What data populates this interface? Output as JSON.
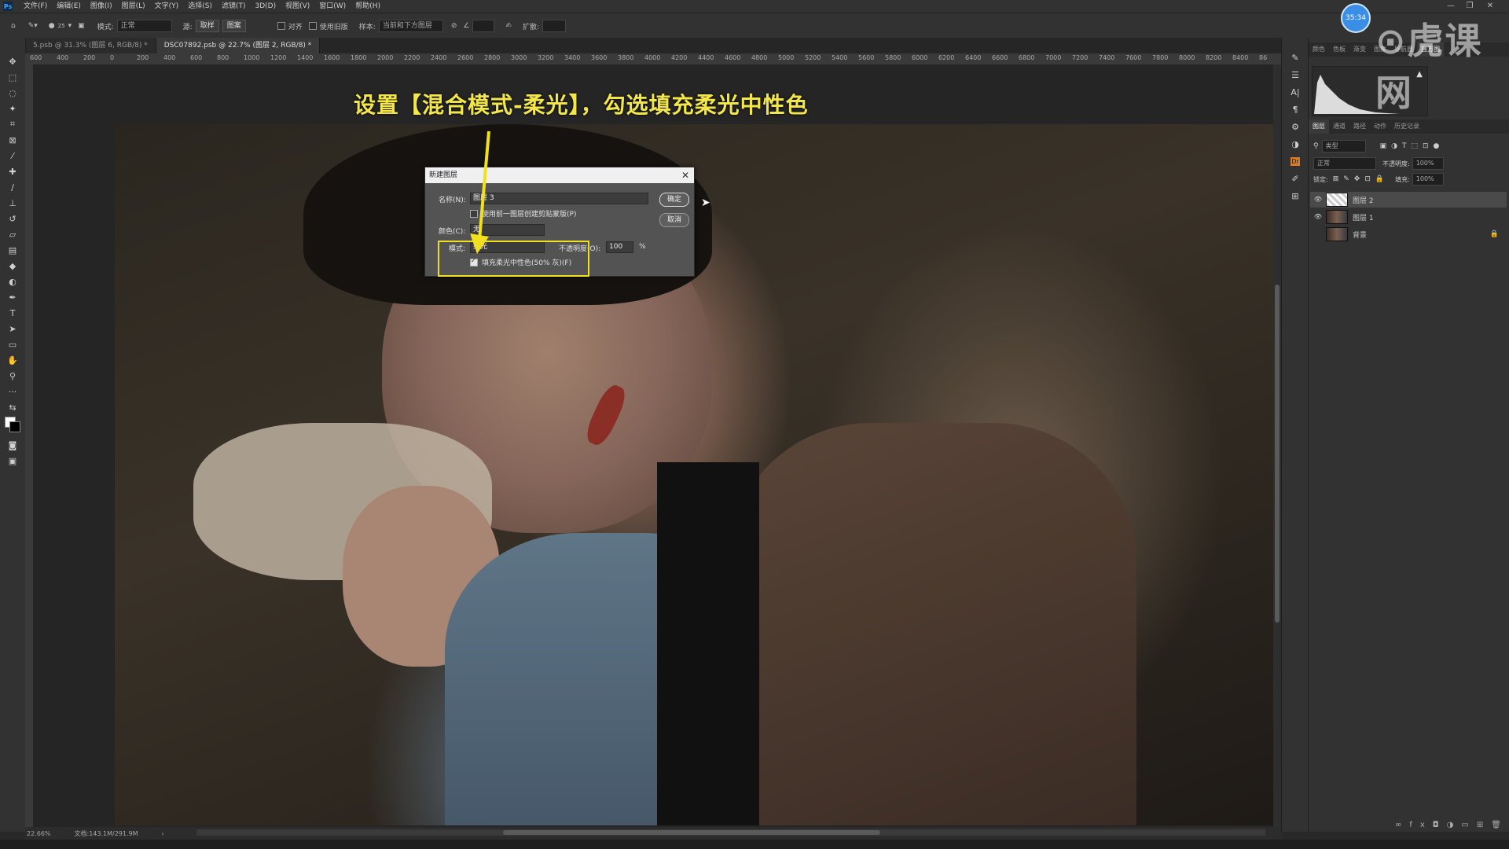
{
  "app": {
    "logo": "Ps",
    "menu": [
      "文件(F)",
      "编辑(E)",
      "图像(I)",
      "图层(L)",
      "文字(Y)",
      "选择(S)",
      "滤镜(T)",
      "3D(D)",
      "视图(V)",
      "窗口(W)",
      "帮助(H)"
    ],
    "window_controls": [
      "—",
      "❐",
      "✕"
    ]
  },
  "options_bar": {
    "mode_label": "模式:",
    "mode_value": "正常",
    "source_label": "源:",
    "source_sample": "取样",
    "source_pattern": "图案",
    "aligned_label": "对齐",
    "legacy_label": "使用旧版",
    "sample_label": "样本:",
    "sample_value": "当前和下方图层",
    "diffusion_label": "扩散:",
    "brush_size": "25"
  },
  "tabs": [
    {
      "label": "5.psb @ 31.3% (图层 6, RGB/8) *",
      "active": false
    },
    {
      "label": "DSC07892.psb @ 22.7% (图层 2, RGB/8) *",
      "active": true
    }
  ],
  "ruler_ticks": [
    "600",
    "400",
    "200",
    "0",
    "200",
    "400",
    "600",
    "800",
    "1000",
    "1200",
    "1400",
    "1600",
    "1800",
    "2000",
    "2200",
    "2400",
    "2600",
    "2800",
    "3000",
    "3200",
    "3400",
    "3600",
    "3800",
    "4000",
    "4200",
    "4400",
    "4600",
    "4800",
    "5000",
    "5200",
    "5400",
    "5600",
    "5800",
    "6000",
    "6200",
    "6400",
    "6600",
    "6800",
    "7000",
    "7200",
    "7400",
    "7600",
    "7800",
    "8000",
    "8200",
    "8400",
    "86"
  ],
  "caption": "设置【混合模式-柔光】，勾选填充柔光中性色",
  "dialog": {
    "title": "新建图层",
    "name_label": "名称(N):",
    "name_value": "图层 3",
    "clip_label": "使用前一图层创建剪贴蒙版(P)",
    "color_label": "颜色(C):",
    "color_value": "无",
    "mode_label": "模式:",
    "mode_value": "柔光",
    "opacity_label": "不透明度(O):",
    "opacity_value": "100",
    "opacity_unit": "%",
    "fill_label": "填充柔光中性色(50% 灰)(F)",
    "fill_checked": true,
    "ok_label": "确定",
    "cancel_label": "取消"
  },
  "status": {
    "zoom": "22.66%",
    "doc": "文档:143.1M/291.9M",
    "arrow": "›"
  },
  "right_panel": {
    "top_tabs": [
      "颜色",
      "色板",
      "渐变",
      "图案",
      "导航器",
      "直方图"
    ],
    "layer_tabs": [
      "图层",
      "通道",
      "路径",
      "动作",
      "历史记录"
    ],
    "layer_filter": "类型",
    "blend_mode": "正常",
    "opacity_label": "不透明度:",
    "opacity_value": "100%",
    "lock_label": "锁定:",
    "fill_label": "填充:",
    "fill_value": "100%",
    "layers": [
      {
        "name": "图层 2",
        "selected": true,
        "visible": true,
        "locked": false
      },
      {
        "name": "图层 1",
        "selected": false,
        "visible": true,
        "locked": false
      },
      {
        "name": "背景",
        "selected": false,
        "visible": false,
        "locked": true
      }
    ]
  },
  "watermark": {
    "text": "虎课网",
    "badge": "35:34"
  },
  "colors": {
    "highlight": "#f0e020",
    "caption": "#f2e64a",
    "panel_bg": "#323232"
  }
}
